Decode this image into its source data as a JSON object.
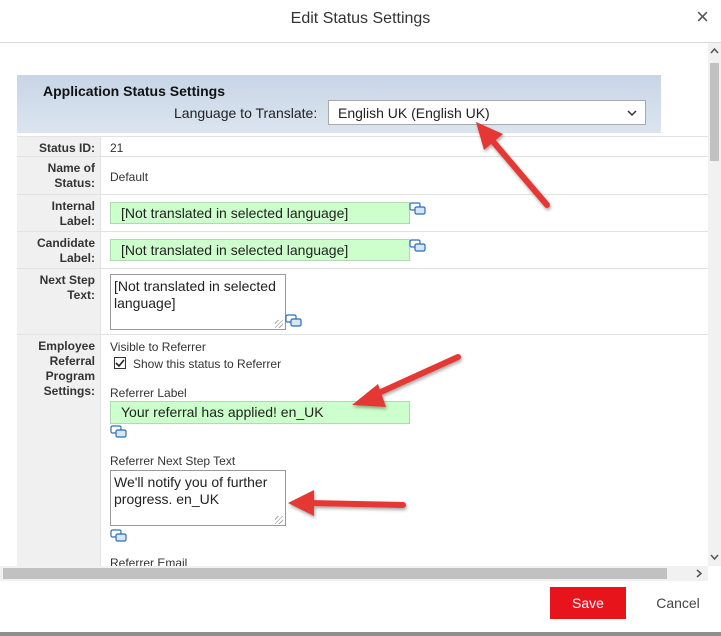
{
  "dialog": {
    "title": "Edit Status Settings",
    "close_glyph": "×",
    "close_icon": "close-icon"
  },
  "section": {
    "title": "Application Status Settings",
    "language_label": "Language to Translate:",
    "language_value": "English UK (English UK)"
  },
  "fields": {
    "status_id": {
      "label": "Status ID:",
      "value": "21"
    },
    "name_of_status": {
      "label_line1": "Name of",
      "label_line2": "Status:",
      "value": "Default"
    },
    "internal_label": {
      "label_line1": "Internal",
      "label_line2": "Label:",
      "value": "[Not translated in selected language]"
    },
    "candidate_label": {
      "label_line1": "Candidate",
      "label_line2": "Label:",
      "value": "[Not translated in selected language]"
    },
    "next_step_text": {
      "label_line1": "Next Step",
      "label_line2": "Text:",
      "value": "[Not translated in selected language]"
    },
    "employee_referral": {
      "label_line1": "Employee",
      "label_line2": "Referral",
      "label_line3": "Program",
      "label_line4": "Settings:",
      "visible_to_referrer": "Visible to Referrer",
      "show_checkbox_label": "Show this status to Referrer",
      "show_checked": true,
      "referrer_label_title": "Referrer Label",
      "referrer_label_value": "Your referral has applied! en_UK",
      "referrer_next_step_title": "Referrer Next Step Text",
      "referrer_next_step_value": "We'll notify you of further progress. en_UK",
      "referrer_email_title": "Referrer Email"
    }
  },
  "footer": {
    "save_label": "Save",
    "cancel_label": "Cancel"
  },
  "colors": {
    "translated_field_bg": "#ccffcc",
    "save_button_bg": "#e8141c",
    "annotation_arrow": "#e53935",
    "section_header_bg": "#c8d5e6"
  },
  "icons": [
    "close-icon",
    "chevron-down-icon",
    "translate-bubble-icon",
    "checkbox-checked-icon",
    "scroll-up-icon",
    "scroll-down-icon",
    "scroll-right-icon"
  ]
}
